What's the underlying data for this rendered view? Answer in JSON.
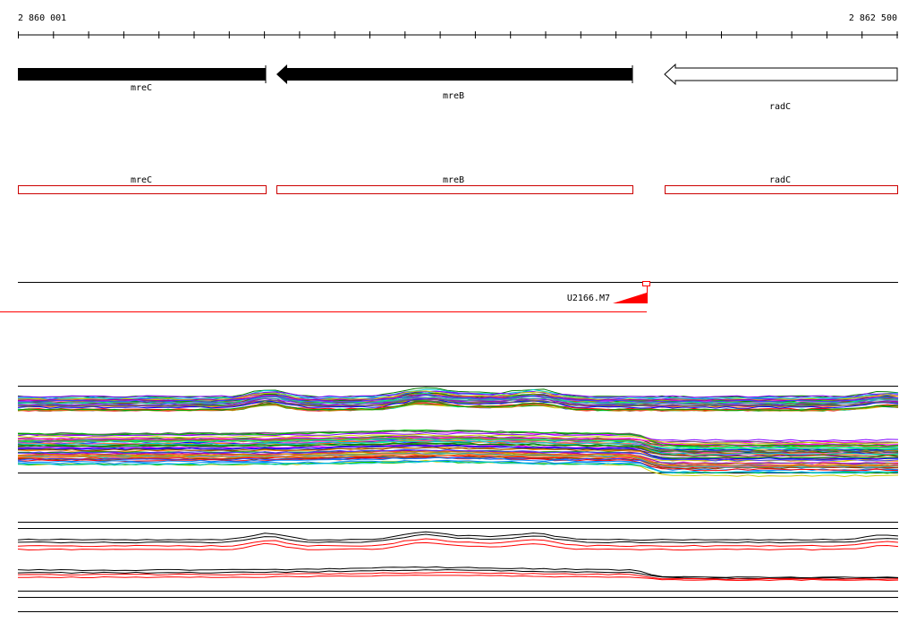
{
  "ruler": {
    "start_label": "2 860 001",
    "end_label": "2 862 500",
    "start": 2860001,
    "end": 2862500
  },
  "genes": [
    {
      "name": "mreC",
      "start": 2860001,
      "end": 2860706,
      "strand": "-",
      "style": "filled"
    },
    {
      "name": "mreB",
      "start": 2860736,
      "end": 2861784,
      "strand": "-",
      "style": "filled"
    },
    {
      "name": "radC",
      "start": 2861876,
      "end": 2862500,
      "strand": "-",
      "style": "open"
    }
  ],
  "cds_features": [
    {
      "name": "mreC",
      "start": 2860001,
      "end": 2860706
    },
    {
      "name": "mreB",
      "start": 2860736,
      "end": 2861784
    },
    {
      "name": "radC",
      "start": 2861876,
      "end": 2862500
    }
  ],
  "transcript": {
    "label": "U2166.M7",
    "position": 2861840,
    "color": "#ff0000"
  },
  "colors": {
    "gene_fill": "#000000",
    "cds_outline": "#cc0000",
    "transcript": "#ff0000",
    "ruler": "#000000"
  }
}
